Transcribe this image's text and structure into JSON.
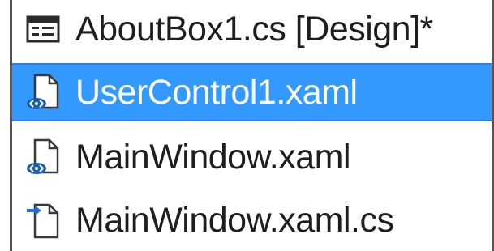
{
  "colors": {
    "selection": "#3399ff",
    "text": "#1e1e1e",
    "selected_text": "#ffffff",
    "xaml_badge": "#1a5fb4",
    "form_icon": "#2b2b2b",
    "cs_arrow": "#1f6fd1"
  },
  "items": [
    {
      "label": "AboutBox1.cs [Design]*",
      "icon": "form-designer-icon",
      "selected": false
    },
    {
      "label": "UserControl1.xaml",
      "icon": "xaml-file-icon",
      "selected": true
    },
    {
      "label": "MainWindow.xaml",
      "icon": "xaml-file-icon",
      "selected": false
    },
    {
      "label": "MainWindow.xaml.cs",
      "icon": "csharp-codebehind-icon",
      "selected": false
    }
  ]
}
